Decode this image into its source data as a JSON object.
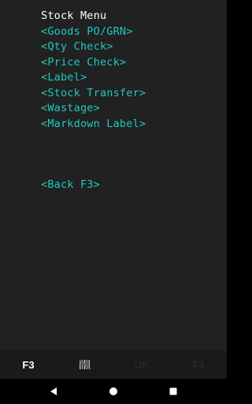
{
  "screen": {
    "title": "Stock Menu",
    "menu_items": [
      {
        "label": "<Goods PO/GRN>"
      },
      {
        "label": "<Qty Check>"
      },
      {
        "label": "<Price Check>"
      },
      {
        "label": "<Label>"
      },
      {
        "label": "<Stock Transfer>"
      },
      {
        "label": "<Wastage>"
      },
      {
        "label": "<Markdown Label>"
      }
    ],
    "back_label": "<Back F3>"
  },
  "function_bar": {
    "f3_label": "F3",
    "scan_icon": "barcode-scan-icon",
    "ok_label": "OK",
    "f4_label": "F4"
  },
  "nav_bar": {
    "back_icon": "back-triangle-icon",
    "home_icon": "home-circle-icon",
    "recents_icon": "recents-square-icon"
  },
  "colors": {
    "background": "#212121",
    "title_text": "#ffffff",
    "menu_text": "#1fc8c0",
    "function_bar": "#1a1a1a",
    "nav_bar": "#000000"
  }
}
